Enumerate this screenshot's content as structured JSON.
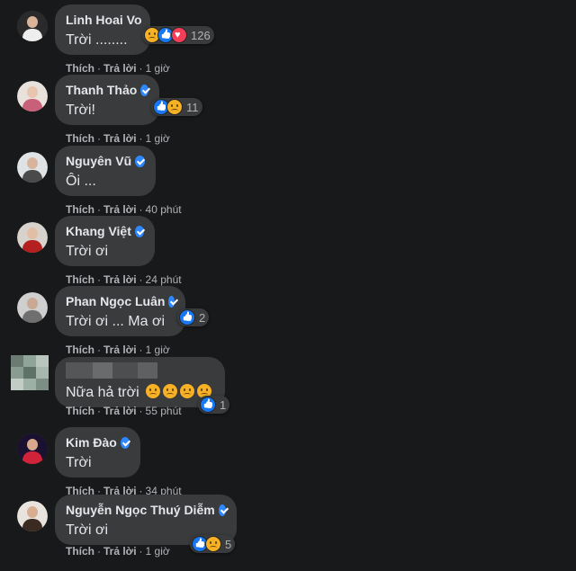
{
  "action_labels": {
    "like": "Thích",
    "reply": "Trả lời"
  },
  "colors": {
    "background": "#18191a",
    "bubble": "#3a3b3c",
    "verified": "#2d88ff",
    "like": "#1877f2",
    "sad": "#f7b125",
    "love": "#f33e58"
  },
  "comments": [
    {
      "name": "Linh Hoai Vo",
      "verified": false,
      "text": "Trời ........",
      "time": "1 giờ",
      "reactions": [
        "sad",
        "like",
        "love"
      ],
      "reaction_count": "126"
    },
    {
      "name": "Thanh Thảo",
      "verified": true,
      "text": "Trời!",
      "time": "1 giờ",
      "reactions": [
        "like",
        "sad"
      ],
      "reaction_count": "11"
    },
    {
      "name": "Nguyên Vũ",
      "verified": true,
      "text": "Ôi ...",
      "time": "40 phút",
      "reactions": [],
      "reaction_count": ""
    },
    {
      "name": "Khang Việt",
      "verified": true,
      "text": "Trời ơi",
      "time": "24 phút",
      "reactions": [],
      "reaction_count": ""
    },
    {
      "name": "Phan Ngọc Luân",
      "verified": true,
      "text": "Trời ơi ... Ma ơi",
      "time": "1 giờ",
      "reactions": [
        "like"
      ],
      "reaction_count": "2"
    },
    {
      "name": "",
      "verified": false,
      "text": "Nữa hả trời",
      "time": "55 phút",
      "reactions": [
        "like"
      ],
      "reaction_count": "1",
      "blurred_author": true
    },
    {
      "name": "Kim Đào",
      "verified": true,
      "text": "Trời",
      "time": "34 phút",
      "reactions": [],
      "reaction_count": ""
    },
    {
      "name": "Nguyễn Ngọc Thuý Diễm",
      "verified": true,
      "text": "Trời ơi",
      "time": "1 giờ",
      "reactions": [
        "like",
        "sad"
      ],
      "reaction_count": "5"
    }
  ]
}
